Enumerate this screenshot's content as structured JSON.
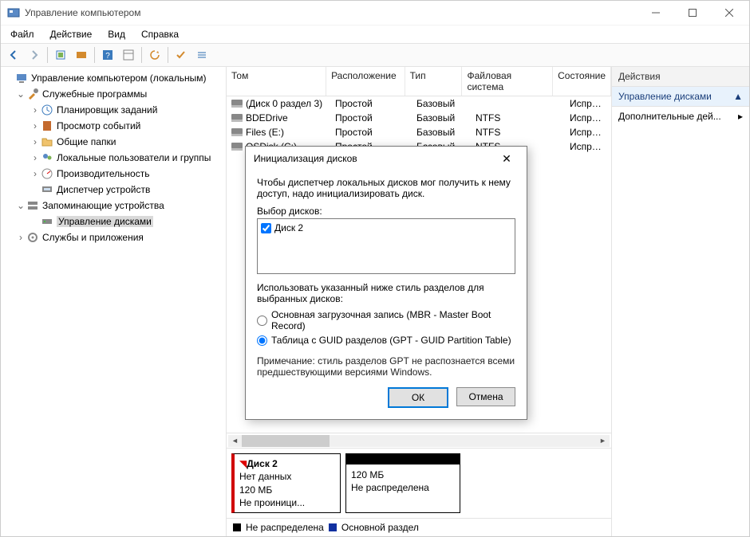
{
  "window": {
    "title": "Управление компьютером"
  },
  "menu": {
    "file": "Файл",
    "action": "Действие",
    "view": "Вид",
    "help": "Справка"
  },
  "tree": {
    "root": "Управление компьютером (локальным)",
    "tools": "Служебные программы",
    "scheduler": "Планировщик заданий",
    "events": "Просмотр событий",
    "shared": "Общие папки",
    "users": "Локальные пользователи и группы",
    "perf": "Производительность",
    "devmgr": "Диспетчер устройств",
    "storage": "Запоминающие устройства",
    "diskmgmt": "Управление дисками",
    "services": "Службы и приложения"
  },
  "cols": {
    "tom": "Том",
    "loc": "Расположение",
    "type": "Тип",
    "fs": "Файловая система",
    "state": "Состояние"
  },
  "volumes": [
    {
      "tom": "(Диск 0 раздел 3)",
      "loc": "Простой",
      "type": "Базовый",
      "fs": "",
      "state": "Исправен (Раздел"
    },
    {
      "tom": "BDEDrive",
      "loc": "Простой",
      "type": "Базовый",
      "fs": "NTFS",
      "state": "Исправен (Систем"
    },
    {
      "tom": "Files (E:)",
      "loc": "Простой",
      "type": "Базовый",
      "fs": "NTFS",
      "state": "Исправен (Файл п"
    },
    {
      "tom": "OSDisk (C:)",
      "loc": "Простой",
      "type": "Базовый",
      "fs": "NTFS",
      "state": "Исправен (Загруз"
    }
  ],
  "diskmap": {
    "name": "Диск 2",
    "nodata": "Нет данных",
    "size": "120 МБ",
    "status": "Не проиници...",
    "region_size": "120 МБ",
    "region_status": "Не распределена"
  },
  "legend": {
    "unalloc": "Не распределена",
    "primary": "Основной раздел"
  },
  "actions": {
    "title": "Действия",
    "section": "Управление дисками",
    "more": "Дополнительные дей..."
  },
  "dialog": {
    "title": "Инициализация дисков",
    "intro": "Чтобы диспетчер локальных дисков мог получить к нему доступ, надо инициализировать диск.",
    "select_label": "Выбор дисков:",
    "disk_item": "Диск 2",
    "style_label": "Использовать указанный ниже стиль разделов для выбранных дисков:",
    "mbr": "Основная загрузочная запись (MBR - Master Boot Record)",
    "gpt": "Таблица с GUID разделов (GPT - GUID Partition Table)",
    "note": "Примечание: стиль разделов GPT не распознается всеми предшествующими версиями Windows.",
    "ok": "ОК",
    "cancel": "Отмена"
  }
}
